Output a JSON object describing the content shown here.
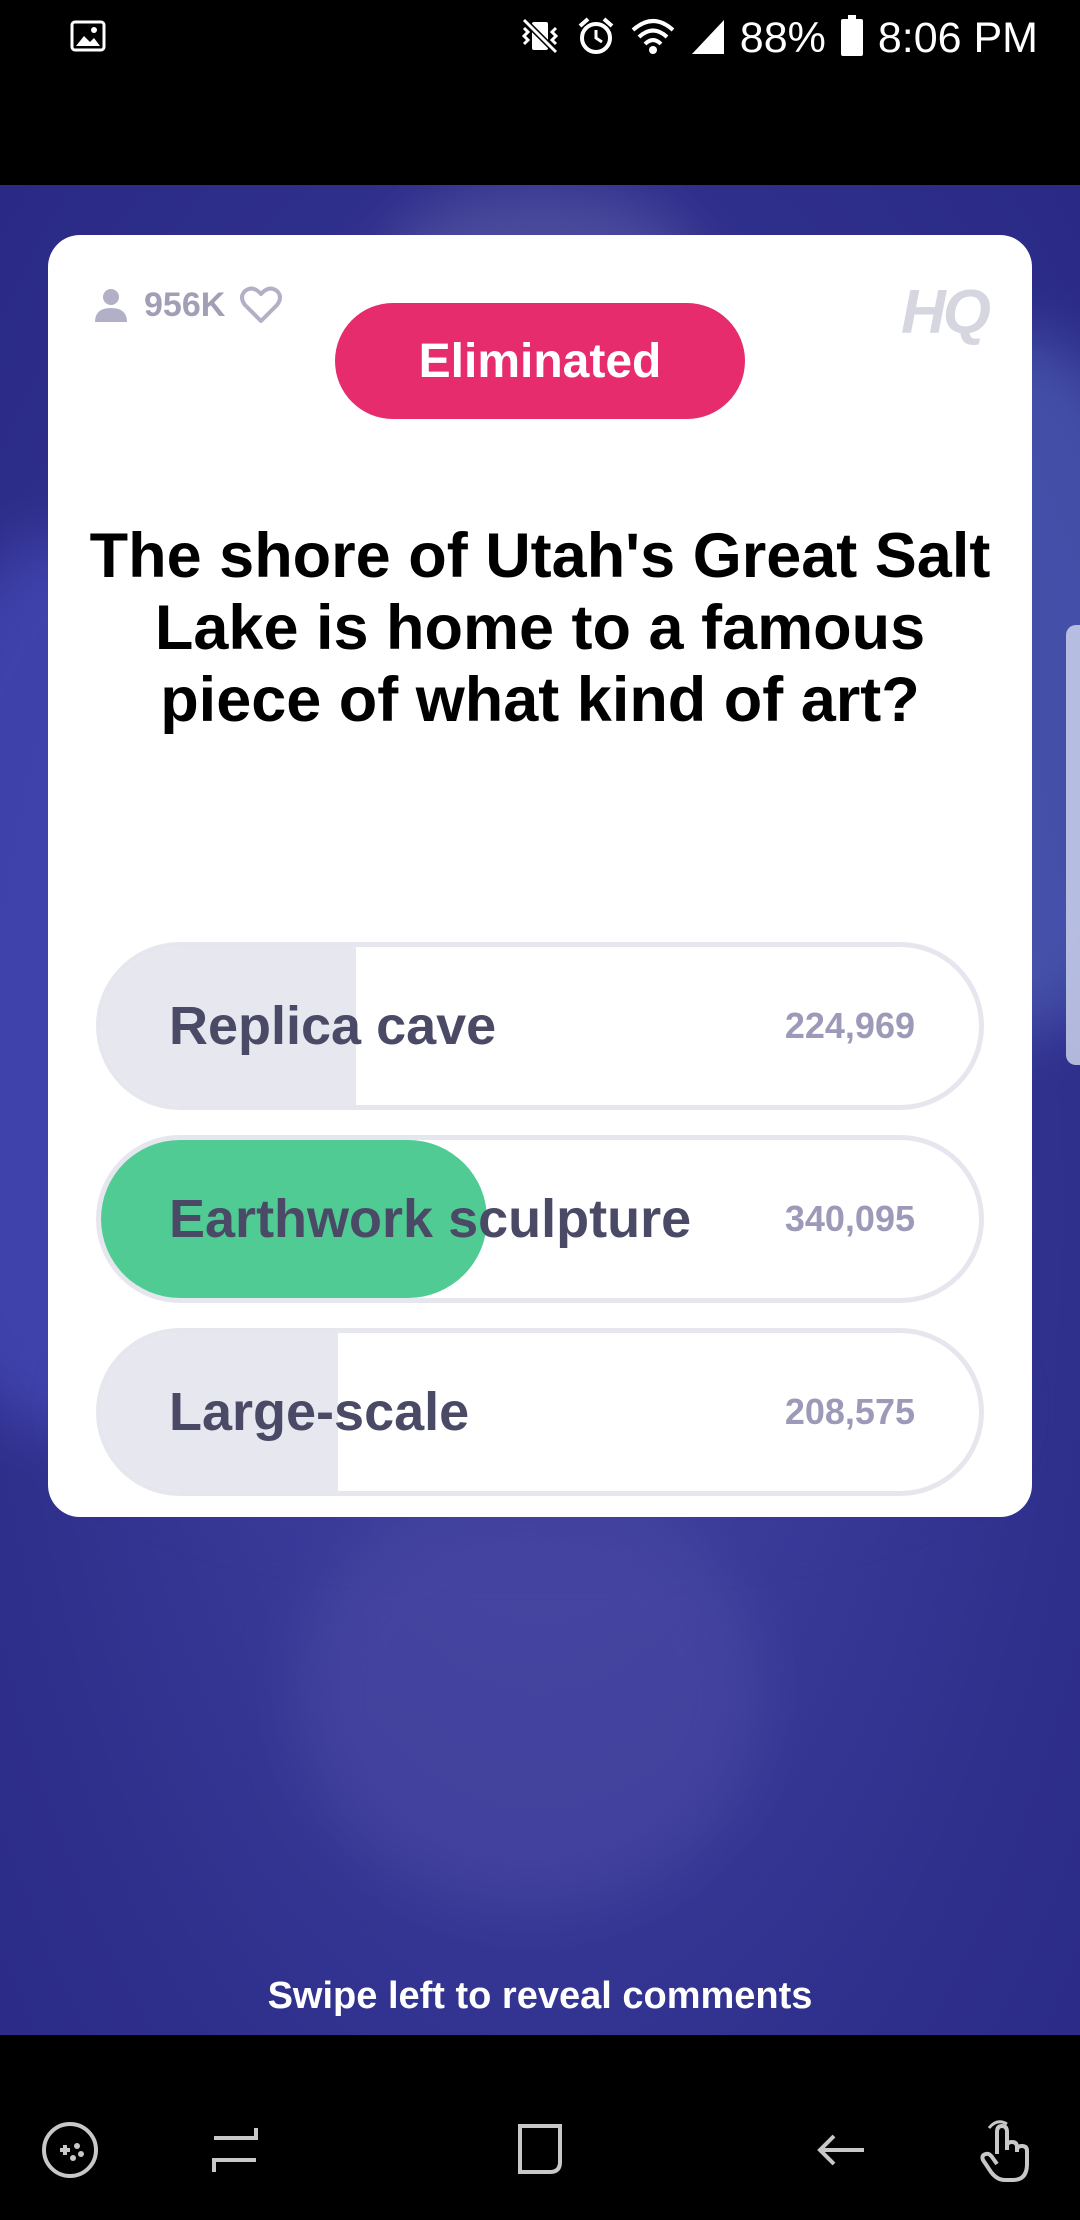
{
  "status_bar": {
    "battery": "88%",
    "time": "8:06 PM",
    "icons": [
      "gallery-icon",
      "mute-vibrate-icon",
      "alarm-icon",
      "wifi-icon",
      "signal-icon",
      "battery-icon"
    ]
  },
  "game": {
    "viewer_count": "956K",
    "logo": "HQ",
    "status_badge": "Eliminated",
    "question": "The shore of Utah's Great Salt Lake is home to a famous piece of what kind of art?",
    "answers": [
      {
        "label": "Replica cave",
        "count": "224,969",
        "fill_fraction": 0.29,
        "correct": false
      },
      {
        "label": "Earthwork sculpture",
        "count": "340,095",
        "fill_fraction": 0.44,
        "correct": true
      },
      {
        "label": "Large-scale",
        "count": "208,575",
        "fill_fraction": 0.27,
        "correct": false
      }
    ],
    "swipe_hint": "Swipe left to reveal comments"
  },
  "colors": {
    "eliminated": "#e72c6e",
    "correct": "#4fcb93",
    "background": "#2f2f8c"
  },
  "nav_bar": {
    "icons": [
      "game-launcher-icon",
      "recent-apps-icon",
      "home-icon",
      "back-icon",
      "gesture-icon"
    ]
  }
}
